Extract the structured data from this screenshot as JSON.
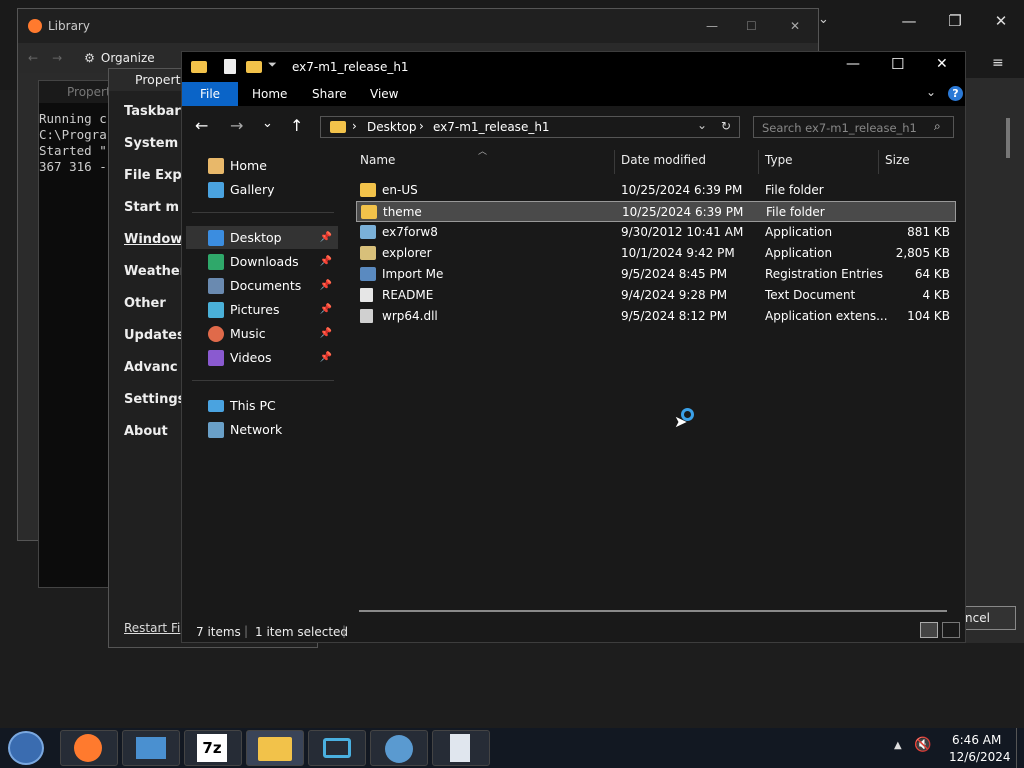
{
  "library": {
    "title": "Library",
    "organize": "Organize"
  },
  "properties": {
    "title": "Propert",
    "items": [
      "Taskbar",
      "System",
      "File Exp",
      "Start m",
      "Window",
      "Weather",
      "Other",
      "Updates",
      "Advanc",
      "Settings",
      "About"
    ],
    "restart": "Restart Fi",
    "cancel": "ncel"
  },
  "cmd": {
    "title": "Propert",
    "lines": [
      "Running c",
      "C:\\Progra",
      "Started \"",
      "367 316 -"
    ]
  },
  "explorer": {
    "title": "ex7-m1_release_h1",
    "tabs": [
      "File",
      "Home",
      "Share",
      "View"
    ],
    "breadcrumb": [
      "Desktop",
      "ex7-m1_release_h1"
    ],
    "search_placeholder": "Search ex7-m1_release_h1",
    "nav": [
      {
        "label": "Home",
        "icon": "home-icon"
      },
      {
        "label": "Gallery",
        "icon": "gallery-icon"
      },
      {
        "label": "Desktop",
        "icon": "desktop-icon",
        "pinned": true
      },
      {
        "label": "Downloads",
        "icon": "downloads-icon",
        "pinned": true
      },
      {
        "label": "Documents",
        "icon": "documents-icon",
        "pinned": true
      },
      {
        "label": "Pictures",
        "icon": "pictures-icon",
        "pinned": true
      },
      {
        "label": "Music",
        "icon": "music-icon",
        "pinned": true
      },
      {
        "label": "Videos",
        "icon": "videos-icon",
        "pinned": true
      },
      {
        "label": "This PC",
        "icon": "pc-icon"
      },
      {
        "label": "Network",
        "icon": "network-icon"
      }
    ],
    "columns": [
      "Name",
      "Date modified",
      "Type",
      "Size"
    ],
    "files": [
      {
        "name": "en-US",
        "date": "10/25/2024 6:39 PM",
        "type": "File folder",
        "size": "",
        "icon": "folder-icon"
      },
      {
        "name": "theme",
        "date": "10/25/2024 6:39 PM",
        "type": "File folder",
        "size": "",
        "icon": "folder-icon"
      },
      {
        "name": "ex7forw8",
        "date": "9/30/2012 10:41 AM",
        "type": "Application",
        "size": "881 KB",
        "icon": "application-icon"
      },
      {
        "name": "explorer",
        "date": "10/1/2024 9:42 PM",
        "type": "Application",
        "size": "2,805 KB",
        "icon": "application-icon"
      },
      {
        "name": "Import Me",
        "date": "9/5/2024 8:45 PM",
        "type": "Registration Entries",
        "size": "64 KB",
        "icon": "registry-icon"
      },
      {
        "name": "README",
        "date": "9/4/2024 9:28 PM",
        "type": "Text Document",
        "size": "4 KB",
        "icon": "text-file-icon"
      },
      {
        "name": "wrp64.dll",
        "date": "9/5/2024 8:12 PM",
        "type": "Application extens...",
        "size": "104 KB",
        "icon": "dll-icon"
      }
    ],
    "selected_index": 1,
    "status_count": "7 items",
    "status_selected": "1 item selected"
  },
  "clock": {
    "time": "6:46 AM",
    "date": "12/6/2024"
  },
  "colors": {
    "accent": "#0a64c8",
    "selection": "#4a4a4a",
    "folder": "#f2c24a"
  }
}
